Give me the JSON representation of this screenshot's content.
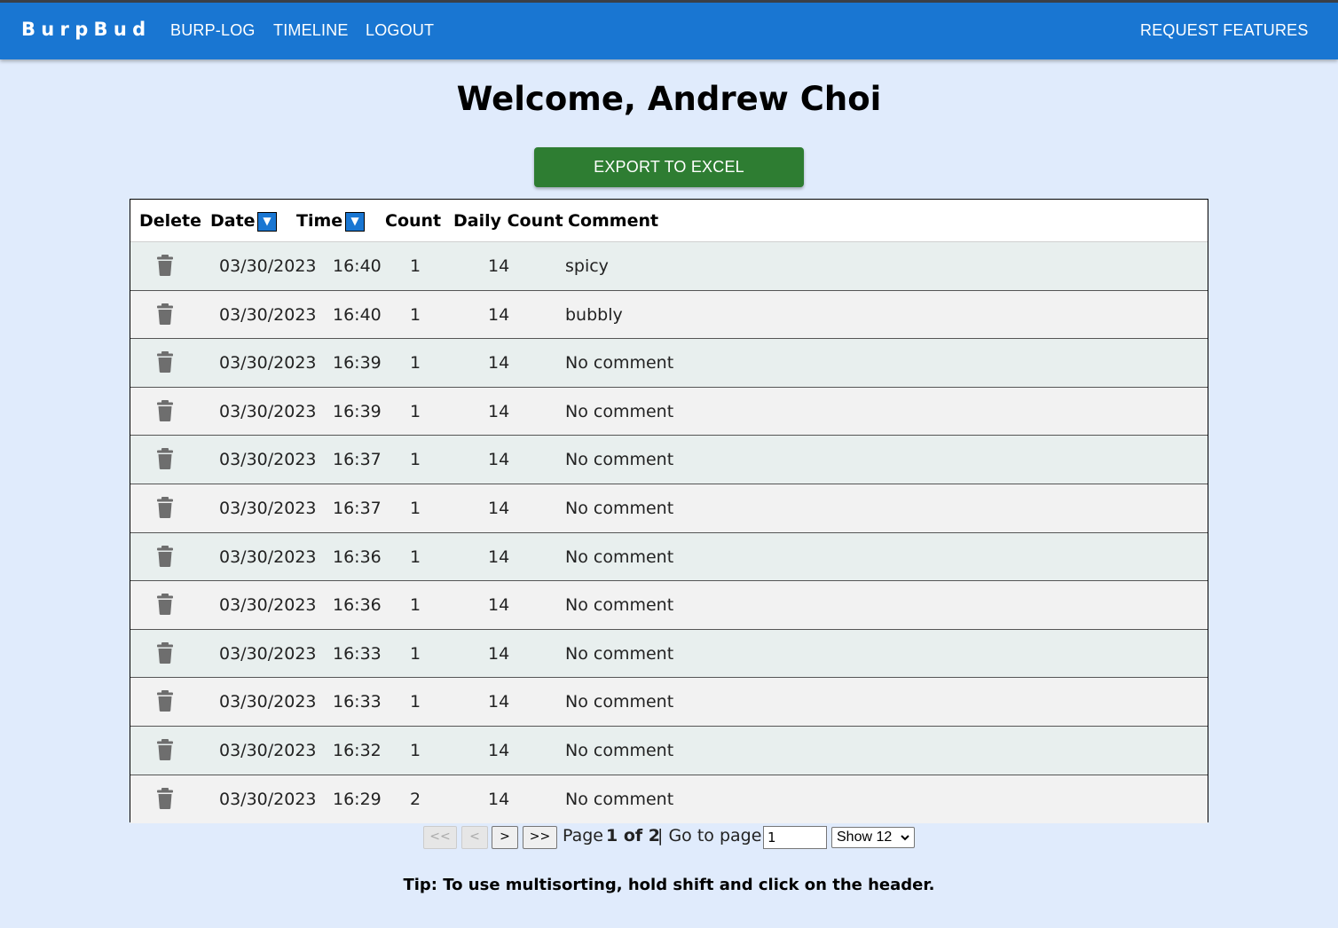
{
  "nav": {
    "brand": "BurpBud",
    "links": [
      "BURP-LOG",
      "TIMELINE",
      "LOGOUT"
    ],
    "request_features": "REQUEST FEATURES"
  },
  "header": {
    "welcome": "Welcome, Andrew Choi"
  },
  "export_label": "EXPORT TO EXCEL",
  "table": {
    "columns": [
      "Delete",
      "Date",
      "Time",
      "Count",
      "Daily Count",
      "Comment"
    ],
    "sort_indicator": "▼",
    "rows": [
      {
        "date": "03/30/2023",
        "time": "16:40",
        "count": "1",
        "daily": "14",
        "comment": "spicy"
      },
      {
        "date": "03/30/2023",
        "time": "16:40",
        "count": "1",
        "daily": "14",
        "comment": "bubbly"
      },
      {
        "date": "03/30/2023",
        "time": "16:39",
        "count": "1",
        "daily": "14",
        "comment": "No comment"
      },
      {
        "date": "03/30/2023",
        "time": "16:39",
        "count": "1",
        "daily": "14",
        "comment": "No comment"
      },
      {
        "date": "03/30/2023",
        "time": "16:37",
        "count": "1",
        "daily": "14",
        "comment": "No comment"
      },
      {
        "date": "03/30/2023",
        "time": "16:37",
        "count": "1",
        "daily": "14",
        "comment": "No comment"
      },
      {
        "date": "03/30/2023",
        "time": "16:36",
        "count": "1",
        "daily": "14",
        "comment": "No comment"
      },
      {
        "date": "03/30/2023",
        "time": "16:36",
        "count": "1",
        "daily": "14",
        "comment": "No comment"
      },
      {
        "date": "03/30/2023",
        "time": "16:33",
        "count": "1",
        "daily": "14",
        "comment": "No comment"
      },
      {
        "date": "03/30/2023",
        "time": "16:33",
        "count": "1",
        "daily": "14",
        "comment": "No comment"
      },
      {
        "date": "03/30/2023",
        "time": "16:32",
        "count": "1",
        "daily": "14",
        "comment": "No comment"
      },
      {
        "date": "03/30/2023",
        "time": "16:29",
        "count": "2",
        "daily": "14",
        "comment": "No comment"
      }
    ]
  },
  "pagination": {
    "first": "<<",
    "prev": "<",
    "next": ">",
    "last": ">>",
    "page_word": "Page",
    "page_of": "1 of 2",
    "goto_label": "| Go to page:",
    "goto_value": "1",
    "show_value": "Show 12"
  },
  "tip": "Tip: To use multisorting, hold shift and click on the header.",
  "colors": {
    "appbar": "#1976d2",
    "export": "#2e7d32",
    "background": "#e0ebfc"
  },
  "icons": {
    "delete": "trash-icon",
    "sort": "sort-desc-icon"
  }
}
